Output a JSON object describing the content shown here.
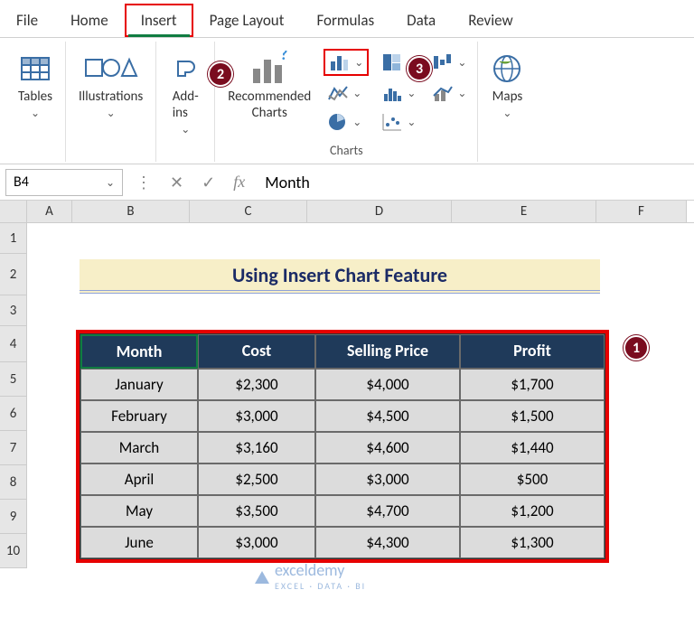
{
  "tabs": {
    "file": "File",
    "home": "Home",
    "insert": "Insert",
    "page_layout": "Page Layout",
    "formulas": "Formulas",
    "data": "Data",
    "review": "Review"
  },
  "ribbon": {
    "tables": "Tables",
    "illustrations": "Illustrations",
    "addins": "Add-\nins",
    "recommended_charts": "Recommended\nCharts",
    "charts_label": "Charts",
    "maps": "Maps"
  },
  "badges": {
    "b1": "1",
    "b2": "2",
    "b3": "3"
  },
  "namebox": "B4",
  "formula": "Month",
  "columns": [
    "A",
    "B",
    "C",
    "D",
    "E",
    "F"
  ],
  "row_nums": [
    "1",
    "2",
    "3",
    "4",
    "5",
    "6",
    "7",
    "8",
    "9",
    "10"
  ],
  "title": "Using Insert Chart Feature",
  "table": {
    "headers": [
      "Month",
      "Cost",
      "Selling Price",
      "Profit"
    ],
    "rows": [
      [
        "January",
        "$2,300",
        "$4,000",
        "$1,700"
      ],
      [
        "February",
        "$3,000",
        "$4,500",
        "$1,500"
      ],
      [
        "March",
        "$3,160",
        "$4,600",
        "$1,440"
      ],
      [
        "April",
        "$2,500",
        "$3,000",
        "$500"
      ],
      [
        "May",
        "$3,500",
        "$4,700",
        "$1,200"
      ],
      [
        "June",
        "$3,000",
        "$4,300",
        "$1,300"
      ]
    ]
  },
  "watermark": {
    "brand": "exceldemy",
    "sub": "EXCEL · DATA · BI"
  }
}
